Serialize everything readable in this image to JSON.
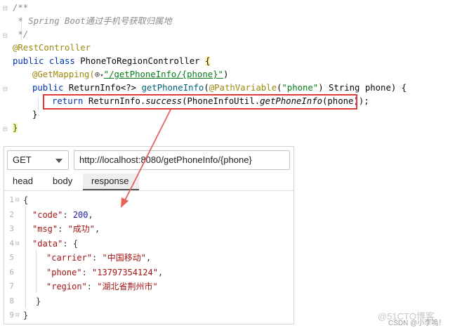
{
  "code": {
    "l1": "/**",
    "l2": " * Spring Boot通过手机号获取归属地",
    "l3": " */",
    "l4_anno": "@RestController",
    "l5_kw": "public class ",
    "l5_name": "PhoneToRegionController ",
    "l5_brace": "{",
    "l6_anno": "@GetMapping(",
    "l6_icon": "⊕",
    "l6_str": "\"/getPhoneInfo/{phone}\"",
    "l6_close": ")",
    "l7_kw": "public ",
    "l7_type": "ReturnInfo<?> ",
    "l7_method": "getPhoneInfo",
    "l7_open": "(",
    "l7_anno": "@PathVariable",
    "l7_arg_open": "(",
    "l7_arg": "\"phone\"",
    "l7_rest": ") String phone) {",
    "l8_kw": "return ",
    "l8_a": "ReturnInfo.",
    "l8_b": "success",
    "l8_c": "(PhoneInfoUtil.",
    "l8_d": "getPhoneInfo",
    "l8_e": "(phone));",
    "l9": "}",
    "l10": "}"
  },
  "request": {
    "method": "GET",
    "url": "http://localhost:8080/getPhoneInfo/{phone}"
  },
  "tabs": [
    "head",
    "body",
    "response"
  ],
  "response": {
    "line_numbers": [
      "1",
      "2",
      "3",
      "4",
      "5",
      "6",
      "7",
      "8",
      "9"
    ],
    "open": "{",
    "code_key": "\"code\"",
    "code_val": "200",
    "msg_key": "\"msg\"",
    "msg_val": "\"成功\"",
    "data_key": "\"data\"",
    "data_open": "{",
    "carrier_key": "\"carrier\"",
    "carrier_val": "\"中国移动\"",
    "phone_key": "\"phone\"",
    "phone_val": "\"13797354124\"",
    "region_key": "\"region\"",
    "region_val": "\"湖北省荆州市\"",
    "data_close": "}",
    "close": "}"
  },
  "watermark": {
    "primary": "@51CTO博客",
    "secondary": "CSDN @小李嗚！"
  },
  "colors": {
    "highlight_box": "#e03b3b",
    "arrow": "#e8615a"
  }
}
